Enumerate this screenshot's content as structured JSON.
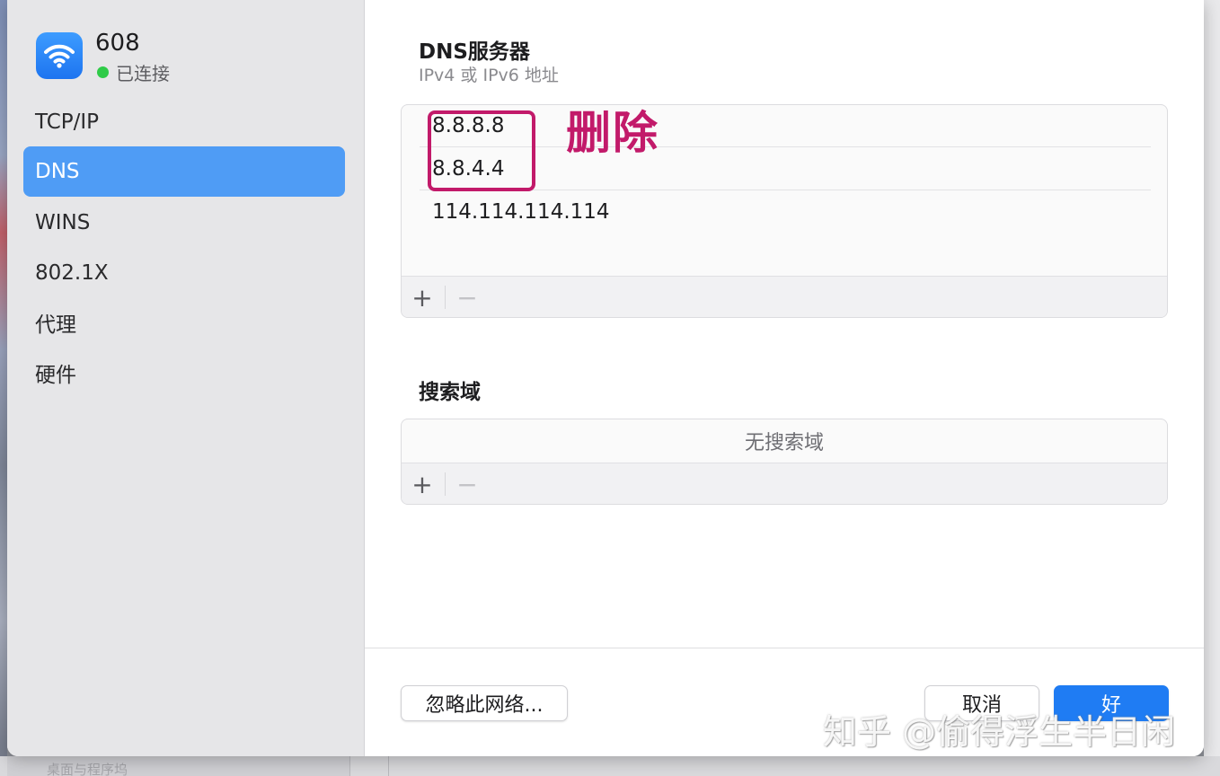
{
  "network": {
    "name": "608",
    "status": "已连接"
  },
  "sidebar": {
    "items": [
      {
        "label": "TCP/IP",
        "active": false
      },
      {
        "label": "DNS",
        "active": true
      },
      {
        "label": "WINS",
        "active": false
      },
      {
        "label": "802.1X",
        "active": false
      },
      {
        "label": "代理",
        "active": false
      },
      {
        "label": "硬件",
        "active": false
      }
    ]
  },
  "dns": {
    "title": "DNS服务器",
    "subtitle": "IPv4 或 IPv6 地址",
    "servers": [
      "8.8.8.8",
      "8.8.4.4",
      "114.114.114.114"
    ],
    "add_label": "+",
    "remove_label": "−"
  },
  "search_domains": {
    "title": "搜索域",
    "empty_text": "无搜索域",
    "add_label": "+",
    "remove_label": "−"
  },
  "footer": {
    "forget_label": "忽略此网络...",
    "cancel_label": "取消",
    "ok_label": "好"
  },
  "annotation": {
    "text": "删除",
    "color": "#c21a6a"
  },
  "watermark": "知乎 @偷得浮生半日闲",
  "background_hint": "桌面与程序坞",
  "colors": {
    "accent": "#1f7cf3",
    "sidebar_selected": "#4f9cf5",
    "connected": "#2fcb48"
  }
}
